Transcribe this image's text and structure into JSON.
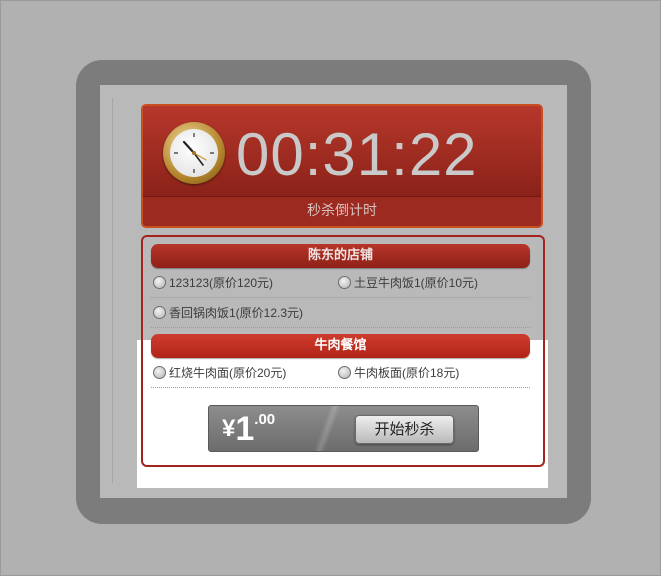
{
  "countdown": {
    "time": "00:31:22",
    "label": "秒杀倒计时"
  },
  "shops": [
    {
      "name": "陈东的店铺",
      "dishes": [
        {
          "label": "123123(原价120元)"
        },
        {
          "label": "土豆牛肉饭1(原价10元)"
        },
        {
          "label": "香回锅肉饭1(原价12.3元)"
        }
      ]
    },
    {
      "name": "牛肉餐馆",
      "dishes": [
        {
          "label": "红烧牛肉面(原价20元)"
        },
        {
          "label": "牛肉板面(原价18元)"
        }
      ]
    }
  ],
  "action": {
    "currency": "¥",
    "price_int": "1",
    "price_dec": ".00",
    "start_label": "开始秒杀"
  },
  "icons": {
    "clock": "clock-icon",
    "radio": "radio-unchecked-icon"
  },
  "colors": {
    "header_red": "#9c2a20",
    "border_red": "#a3241c",
    "frame_gray": "#7c7c7c"
  }
}
